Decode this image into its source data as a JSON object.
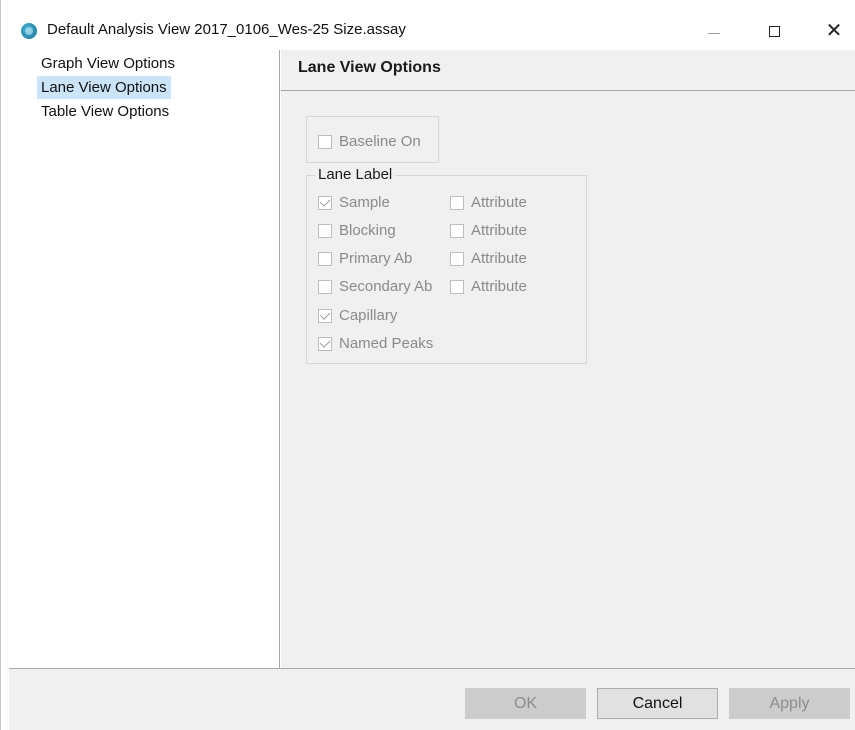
{
  "window": {
    "title": "Default Analysis View 2017_0106_Wes-25 Size.assay",
    "icon": "simple-western-app-icon",
    "controls": {
      "minimize": "minimize-icon",
      "maximize": "maximize-icon",
      "close": "close-icon",
      "close_glyph": "✕"
    }
  },
  "nav": {
    "items": [
      {
        "label": "Graph View Options",
        "selected": false
      },
      {
        "label": "Lane View Options",
        "selected": true
      },
      {
        "label": "Table View Options",
        "selected": false
      }
    ]
  },
  "panel": {
    "title": "Lane View Options",
    "baseline": {
      "label": "Baseline On",
      "checked": false,
      "enabled": false
    },
    "lane_label": {
      "legend": "Lane Label",
      "options": [
        {
          "label": "Sample",
          "checked": true
        },
        {
          "label": "Blocking",
          "checked": false
        },
        {
          "label": "Primary Ab",
          "checked": false
        },
        {
          "label": "Secondary Ab",
          "checked": false
        },
        {
          "label": "Capillary",
          "checked": true
        },
        {
          "label": "Named Peaks",
          "checked": true
        }
      ],
      "attributes": [
        {
          "label": "Attribute",
          "checked": false
        },
        {
          "label": "Attribute",
          "checked": false
        },
        {
          "label": "Attribute",
          "checked": false
        },
        {
          "label": "Attribute",
          "checked": false
        }
      ]
    }
  },
  "buttons": {
    "ok": {
      "label": "OK",
      "enabled": false
    },
    "cancel": {
      "label": "Cancel",
      "enabled": true
    },
    "apply": {
      "label": "Apply",
      "enabled": false
    }
  },
  "colors": {
    "selection": "#cce4f7",
    "panel_bg": "#f0f0f0",
    "disabled_text": "#8a8a8a"
  }
}
